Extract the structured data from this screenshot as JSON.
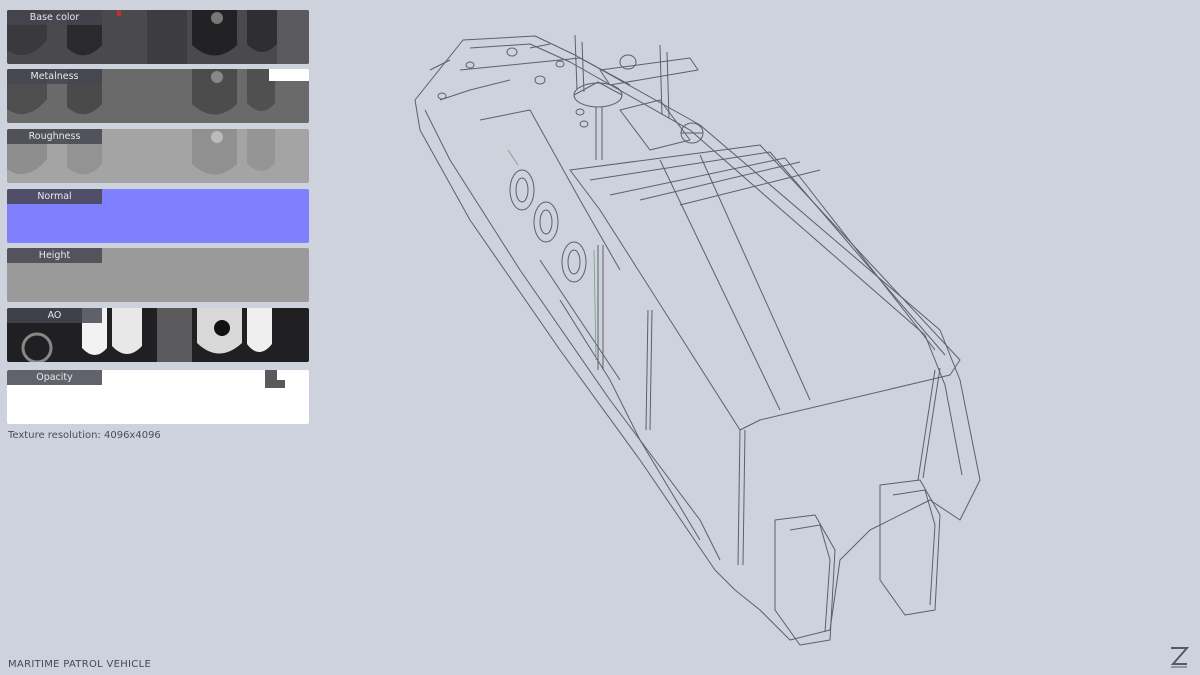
{
  "texture_maps": [
    {
      "label": "Base color"
    },
    {
      "label": "Metalness"
    },
    {
      "label": "Roughness"
    },
    {
      "label": "Normal"
    },
    {
      "label": "Height"
    },
    {
      "label": "AO"
    },
    {
      "label": "Opacity"
    }
  ],
  "colors": {
    "background": "#ced2dc",
    "normal_map": "#8080ff",
    "height_map": "#9a9a9a",
    "wireframe": "#5d606a"
  },
  "texture_resolution": "Texture resolution: 4096x4096",
  "model_title": "MARITIME PATROL VEHICLE",
  "logo_icon": "z-logo-icon"
}
